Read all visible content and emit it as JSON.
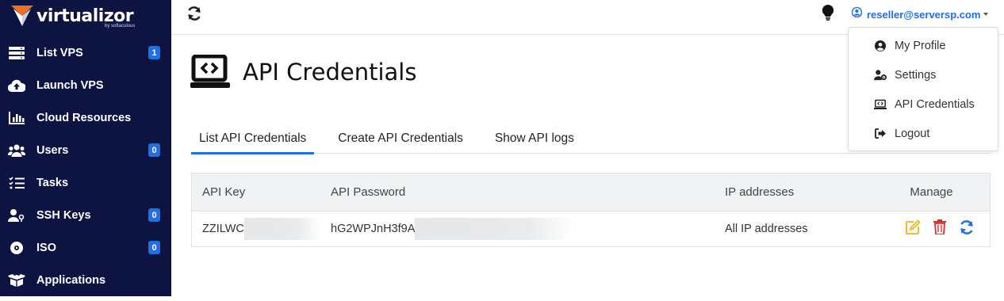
{
  "brand": {
    "name": "virtualizor",
    "tagline": "by softaculous"
  },
  "sidebar": {
    "items": [
      {
        "label": "List VPS",
        "icon": "server-list-icon",
        "badge": "1"
      },
      {
        "label": "Launch VPS",
        "icon": "cloud-upload-icon",
        "badge": ""
      },
      {
        "label": "Cloud Resources",
        "icon": "chart-bar-icon",
        "badge": ""
      },
      {
        "label": "Users",
        "icon": "users-icon",
        "badge": "0"
      },
      {
        "label": "Tasks",
        "icon": "tasks-icon",
        "badge": ""
      },
      {
        "label": "SSH Keys",
        "icon": "user-key-icon",
        "badge": "0"
      },
      {
        "label": "ISO",
        "icon": "disc-icon",
        "badge": "0"
      },
      {
        "label": "Applications",
        "icon": "box-icon",
        "badge": ""
      }
    ]
  },
  "header": {
    "user_email": "reseller@serversp.com"
  },
  "user_menu": {
    "items": [
      {
        "label": "My Profile",
        "icon": "user-circle-icon"
      },
      {
        "label": "Settings",
        "icon": "user-cog-icon"
      },
      {
        "label": "API Credentials",
        "icon": "laptop-code-icon"
      },
      {
        "label": "Logout",
        "icon": "sign-out-icon"
      }
    ]
  },
  "page": {
    "title": "API Credentials"
  },
  "tabs": [
    {
      "label": "List API Credentials",
      "active": true
    },
    {
      "label": "Create API Credentials",
      "active": false
    },
    {
      "label": "Show API logs",
      "active": false
    }
  ],
  "table": {
    "columns": [
      "API Key",
      "API Password",
      "IP addresses",
      "Manage"
    ],
    "rows": [
      {
        "api_key": "ZZILWC",
        "api_password": "hG2WPJnH3f9A",
        "ip_addresses": "All IP addresses"
      }
    ]
  },
  "colors": {
    "sidebar_bg": "#0d1442",
    "accent": "#1f6fe5",
    "edit": "#f2b01e",
    "delete": "#dc2d2d"
  }
}
